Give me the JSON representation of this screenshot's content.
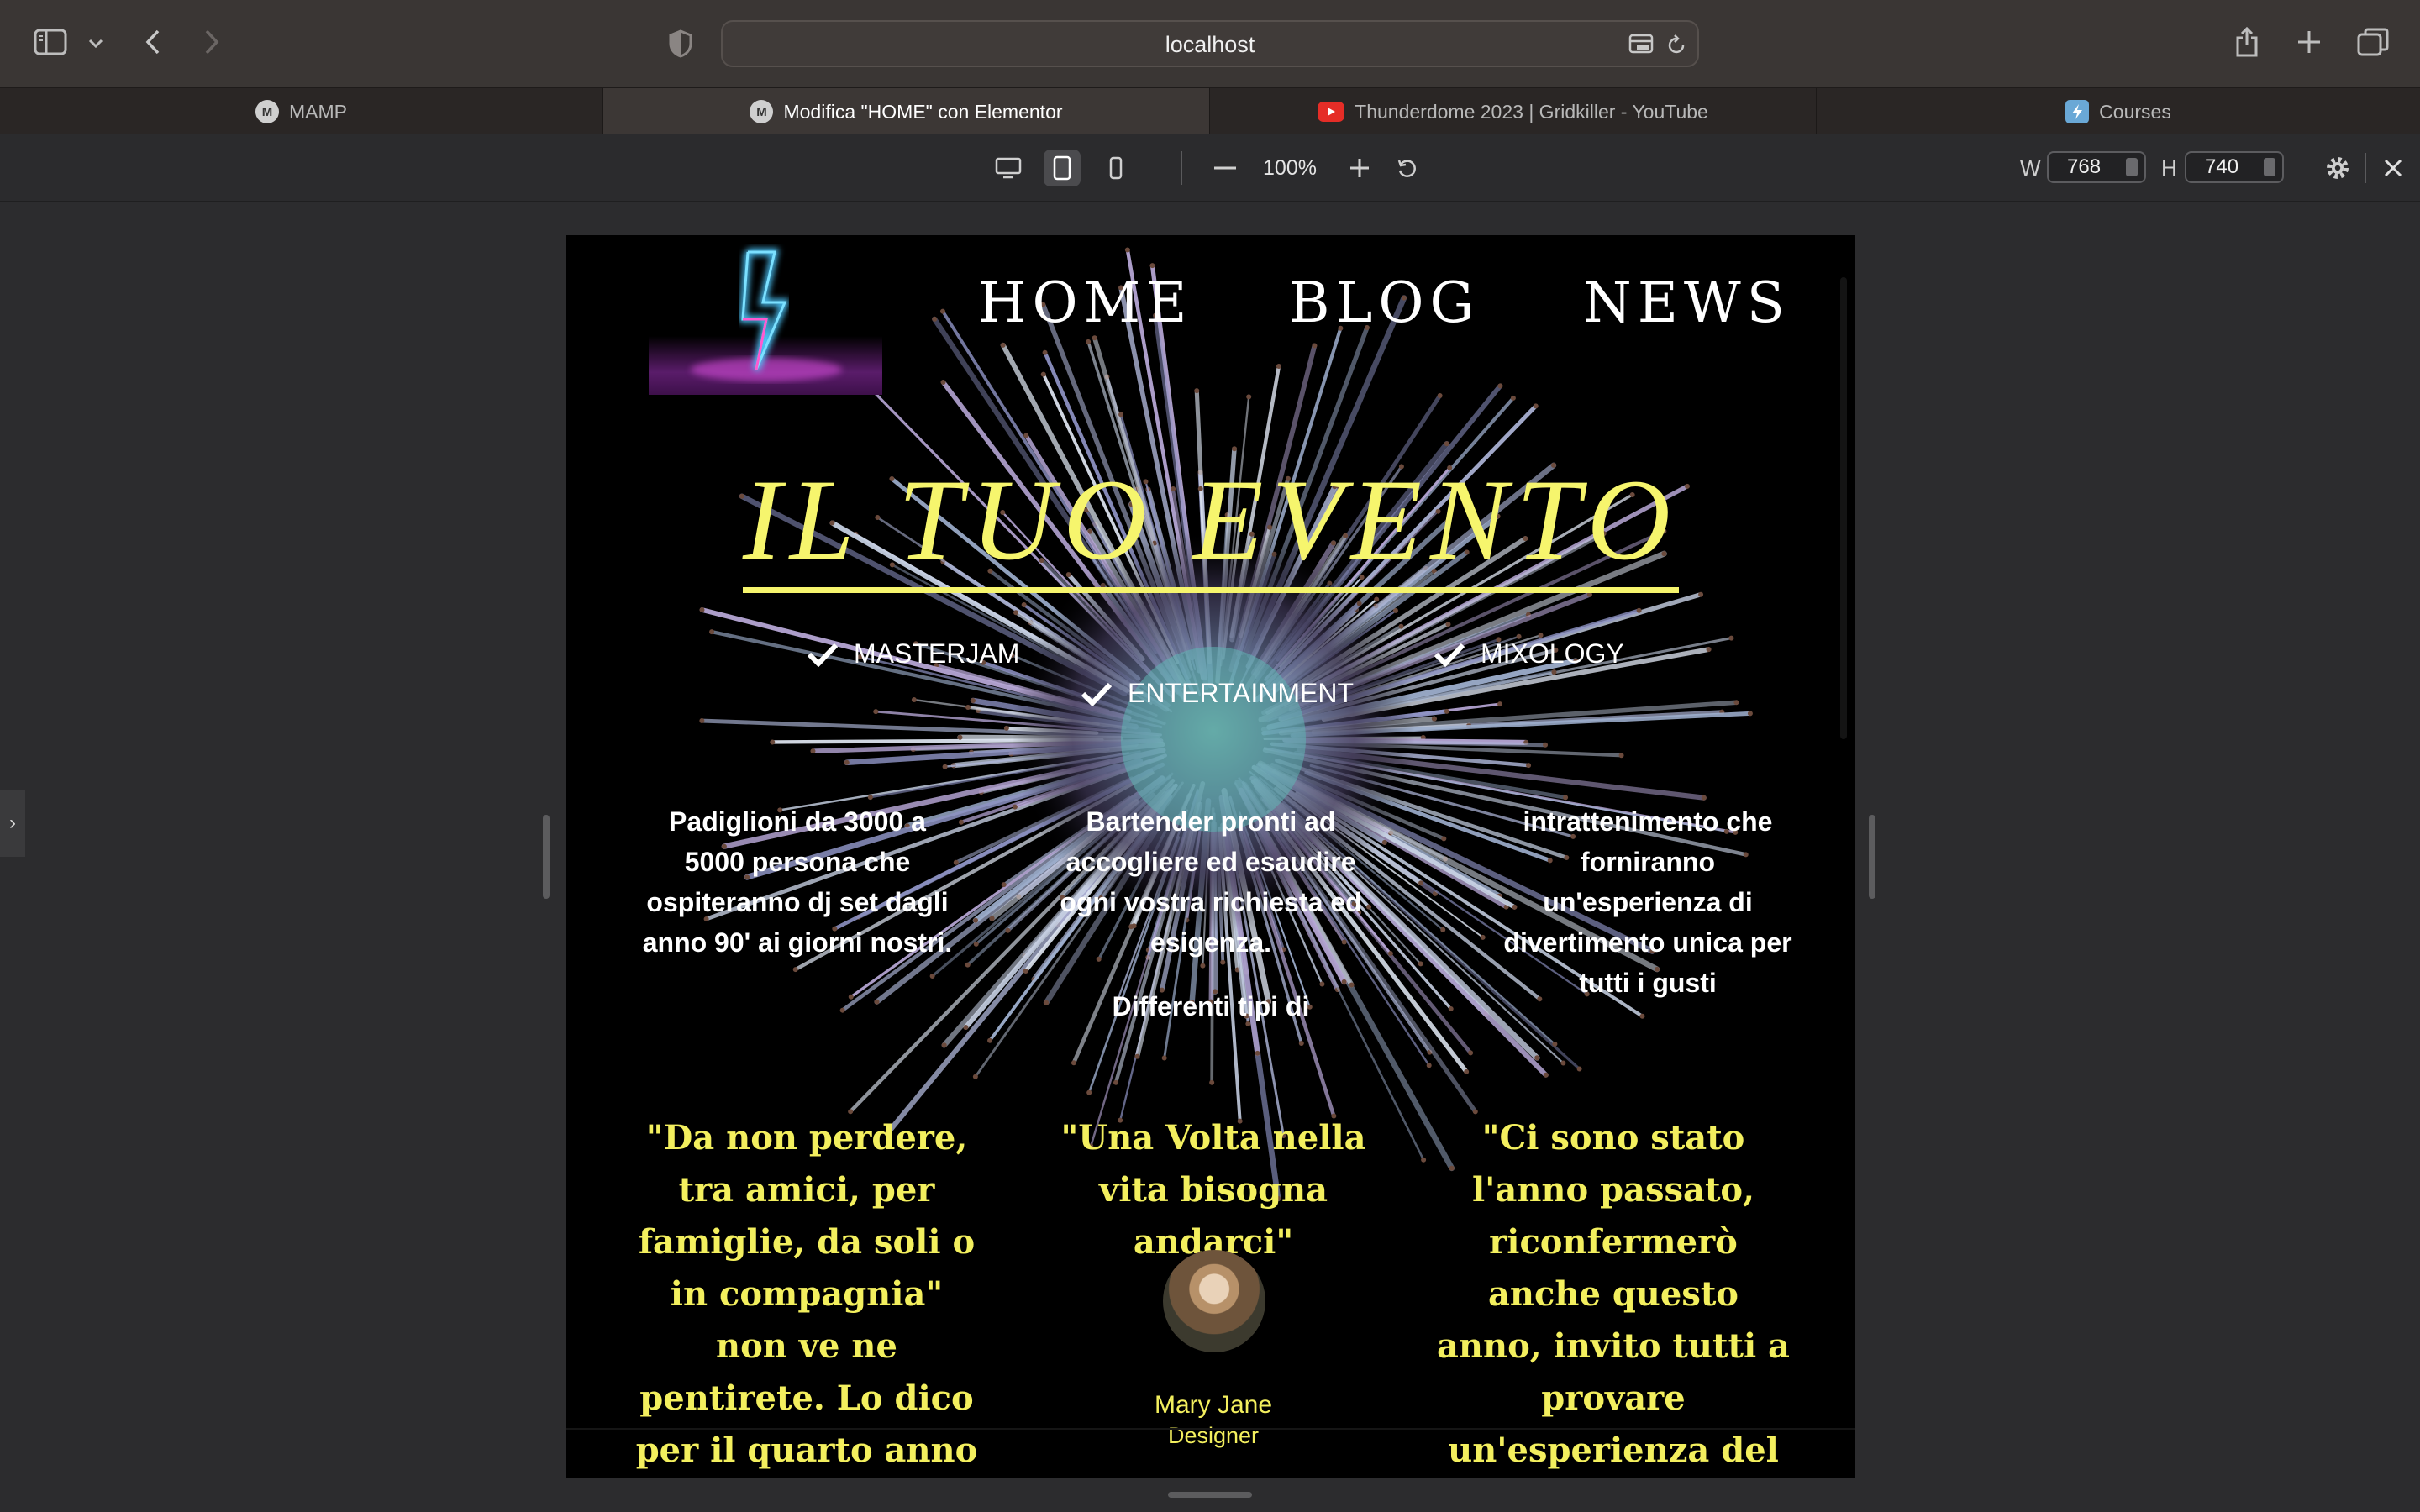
{
  "browser": {
    "url": "localhost",
    "tabs": [
      {
        "label": "MAMP",
        "icon": "mamp-icon",
        "active": false
      },
      {
        "label": "Modifica \"HOME\" con Elementor",
        "icon": "mamp-icon",
        "active": true
      },
      {
        "label": "Thunderdome 2023 | Gridkiller - YouTube",
        "icon": "youtube-icon",
        "active": false
      },
      {
        "label": "Courses",
        "icon": "courses-icon",
        "active": false
      }
    ]
  },
  "responsive": {
    "zoom": "100%",
    "width_label": "W",
    "width_value": "768",
    "height_label": "H",
    "height_value": "740"
  },
  "site": {
    "nav": [
      "HOME",
      "BLOG",
      "NEWS"
    ],
    "hero_title": "IL TUO EVENTO",
    "features": [
      "MASTERJAM",
      "ENTERTAINMENT",
      "MIXOLOGY"
    ],
    "col1": "Padiglioni da 3000 a 5000 persona che ospiteranno dj set dagli anno 90' ai giorni nostri.",
    "col2a": "Bartender pronti ad accogliere ed esaudire ogni vostra richiesta ed esigenza.",
    "col2b": "Differenti tipi di",
    "col3": "intrattenimento che forniranno un'esperienza di divertimento unica per tutti i gusti",
    "quote1": "\"Da non perdere, tra amici, per famiglie, da soli o in compagnia\" non ve ne pentirete. Lo dico per il quarto anno consecutivo.\"",
    "quote2": "\"Una Volta nella vita bisogna andarci\"",
    "quote3": "\"Ci sono stato l'anno passato, riconfermerò anche questo anno, invito tutti a provare un'esperienza del genere\"",
    "person_name": "Mary Jane",
    "person_role": "Designer"
  },
  "colors": {
    "accent_yellow": "#f6f56d",
    "page_bg": "#000000",
    "chrome_bg": "#3a3634"
  }
}
